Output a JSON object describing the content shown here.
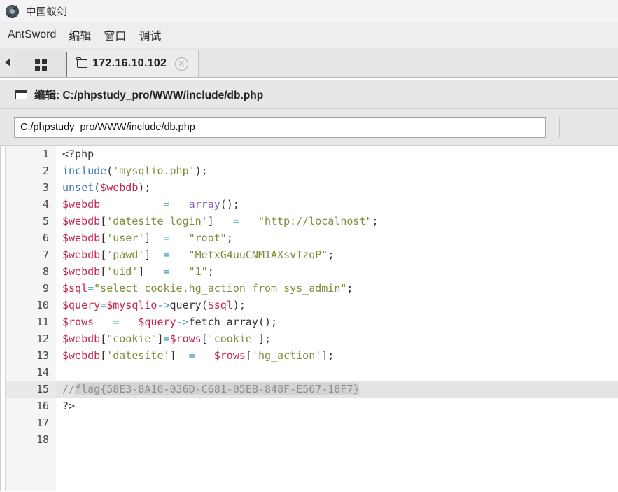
{
  "titlebar": {
    "app_icon": "antsword-logo-icon",
    "title": "中国蚁剑"
  },
  "menubar": {
    "items": [
      {
        "label": "AntSword"
      },
      {
        "label": "编辑"
      },
      {
        "label": "窗口"
      },
      {
        "label": "调试"
      }
    ]
  },
  "tabstrip": {
    "scroll_left_icon": "caret-left-icon",
    "grid_tab_icon": "grid-icon",
    "tabs": [
      {
        "label": "172.16.10.102",
        "icon": "folder-icon",
        "close_icon": "close-circle-icon",
        "active": true
      }
    ]
  },
  "panel": {
    "window_icon": "window-icon",
    "title": "编辑: C:/phpstudy_pro/WWW/include/db.php",
    "path_input": {
      "value": "C:/phpstudy_pro/WWW/include/db.php",
      "placeholder": "C:/phpstudy_pro/WWW/include/db.php"
    }
  },
  "editor": {
    "selected_line": 15,
    "line_numbers": [
      "1",
      "2",
      "3",
      "4",
      "5",
      "6",
      "7",
      "8",
      "9",
      "10",
      "11",
      "12",
      "13",
      "14",
      "15",
      "16",
      "17",
      "18"
    ],
    "lines": [
      {
        "n": "1",
        "text": "<?php"
      },
      {
        "n": "2",
        "text": "include('mysqlio.php');"
      },
      {
        "n": "3",
        "text": "unset($webdb);"
      },
      {
        "n": "4",
        "text": "$webdb          =   array();"
      },
      {
        "n": "5",
        "text": "$webdb['datesite_login']   =   \"http://localhost\";"
      },
      {
        "n": "6",
        "text": "$webdb['user']  =   \"root\";"
      },
      {
        "n": "7",
        "text": "$webdb['pawd']  =   \"MetxG4uuCNM1AXsvTzqP\";"
      },
      {
        "n": "8",
        "text": "$webdb['uid']   =   \"1\";"
      },
      {
        "n": "9",
        "text": "$sql=\"select cookie,hg_action from sys_admin\";"
      },
      {
        "n": "10",
        "text": "$query=$mysqlio->query($sql);"
      },
      {
        "n": "11",
        "text": "$rows   =   $query->fetch_array();"
      },
      {
        "n": "12",
        "text": "$webdb[\"cookie\"]=$rows['cookie'];"
      },
      {
        "n": "13",
        "text": "$webdb['datesite']  =   $rows['hg_action'];"
      },
      {
        "n": "14",
        "text": ""
      },
      {
        "n": "15",
        "text": "//flag{58E3-8A10-036D-C681-05EB-848F-E567-18F7}"
      },
      {
        "n": "16",
        "text": "?>"
      },
      {
        "n": "17",
        "text": ""
      },
      {
        "n": "18",
        "text": ""
      }
    ],
    "flag": "flag{58E3-8A10-036D-C681-05EB-848F-E567-18F7}",
    "credentials": {
      "datesite_login": "http://localhost",
      "user": "root",
      "pawd": "MetxG4uuCNM1AXsvTzqP",
      "uid": "1"
    },
    "sql_query": "select cookie,hg_action from sys_admin"
  },
  "colors": {
    "variable": "#c7254e",
    "function": "#3a74b8",
    "string": "#7f8c3a",
    "operator": "#3a9ab5",
    "keyword": "#8a5ec0",
    "comment": "#8e8e8e",
    "selection": "#e4e4e4",
    "chrome": "#e7e7e7"
  }
}
